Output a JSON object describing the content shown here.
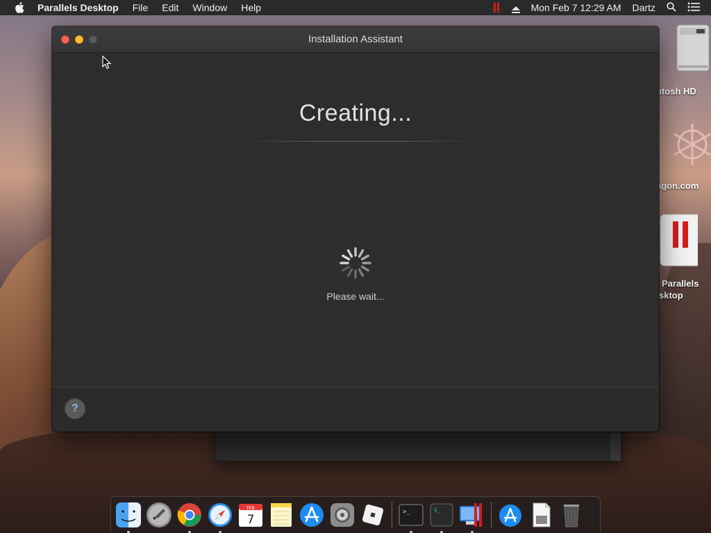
{
  "menubar": {
    "app_name": "Parallels Desktop",
    "items": [
      "File",
      "Edit",
      "Window",
      "Help"
    ],
    "clock": "Mon Feb 7  12:29 AM",
    "user": "Dartz"
  },
  "desktop": {
    "icons": [
      {
        "label": "ntosh HD",
        "icon": "hard-drive-icon"
      },
      {
        "label": "agon.com",
        "icon": "snowflake-logo-icon"
      },
      {
        "label_line1": "Parallels",
        "label_line2": "sktop",
        "icon": "parallels-desktop-icon"
      }
    ]
  },
  "window": {
    "title": "Installation Assistant",
    "heading": "Creating...",
    "status": "Please wait...",
    "help_label": "?"
  },
  "dock": {
    "items": [
      {
        "name": "finder",
        "running": true
      },
      {
        "name": "launchpad",
        "running": false
      },
      {
        "name": "chrome",
        "running": true
      },
      {
        "name": "safari",
        "running": true
      },
      {
        "name": "calendar",
        "running": false,
        "month": "FEB",
        "day": "7"
      },
      {
        "name": "notes",
        "running": false
      },
      {
        "name": "app-store",
        "running": false
      },
      {
        "name": "system-preferences",
        "running": false
      },
      {
        "name": "roblox",
        "running": false
      },
      {
        "name": "terminal",
        "running": true
      },
      {
        "name": "console",
        "running": true
      },
      {
        "name": "parallels-desktop",
        "running": true
      },
      {
        "name": "app-store-downloads",
        "running": false
      },
      {
        "name": "documents",
        "running": false
      },
      {
        "name": "trash",
        "running": false
      }
    ]
  },
  "colors": {
    "close": "#fc5f57",
    "minimize": "#fdbc2e",
    "parallels_red": "#d21f1f",
    "window_bg": "#2d2d2d"
  }
}
